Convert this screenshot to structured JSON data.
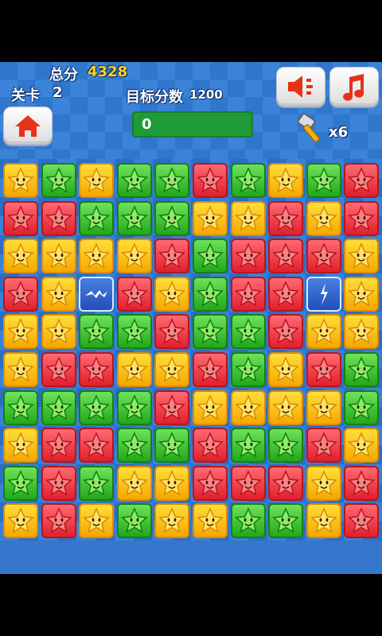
{
  "hud": {
    "total_label": "总分",
    "total_value": "4328",
    "level_label": "关卡",
    "level_value": "2",
    "target_label": "目标分数",
    "target_value": "1200",
    "progress_value": "0",
    "hammer_count": "x6"
  },
  "board": {
    "rows": [
      [
        "yellow",
        "green",
        "yellow",
        "green",
        "green",
        "red",
        "green",
        "yellow",
        "green",
        "red"
      ],
      [
        "red",
        "red",
        "green",
        "green",
        "green",
        "yellow",
        "yellow",
        "red",
        "yellow",
        "red"
      ],
      [
        "yellow",
        "yellow",
        "yellow",
        "yellow",
        "red",
        "green",
        "red",
        "red",
        "red",
        "yellow"
      ],
      [
        "red",
        "yellow",
        "special-h",
        "red",
        "yellow",
        "green",
        "red",
        "red",
        "special-v",
        "yellow"
      ],
      [
        "yellow",
        "yellow",
        "green",
        "green",
        "red",
        "green",
        "green",
        "red",
        "yellow",
        "yellow"
      ],
      [
        "yellow",
        "red",
        "red",
        "yellow",
        "yellow",
        "red",
        "green",
        "yellow",
        "red",
        "green"
      ],
      [
        "green",
        "green",
        "green",
        "green",
        "red",
        "yellow",
        "yellow",
        "yellow",
        "yellow",
        "green"
      ],
      [
        "yellow",
        "red",
        "red",
        "green",
        "green",
        "red",
        "green",
        "green",
        "red",
        "yellow"
      ],
      [
        "green",
        "red",
        "green",
        "yellow",
        "yellow",
        "red",
        "red",
        "red",
        "yellow",
        "red"
      ],
      [
        "yellow",
        "red",
        "yellow",
        "green",
        "yellow",
        "yellow",
        "green",
        "green",
        "yellow",
        "red"
      ]
    ]
  },
  "colors": {
    "yellow": "#f8c21c",
    "red": "#e8323c",
    "green": "#3cc22a",
    "special": "#2f62c8"
  },
  "icons": {
    "home": "home-icon",
    "sound": "speaker-icon",
    "music": "music-note-icon",
    "hammer": "hammer-icon"
  }
}
